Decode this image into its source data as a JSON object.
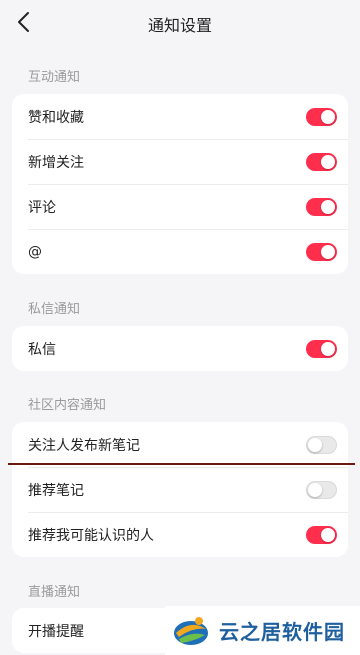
{
  "header": {
    "title": "通知设置",
    "back_icon": "chevron-left-icon"
  },
  "sections": [
    {
      "title": "互动通知",
      "items": [
        {
          "label": "赞和收藏",
          "enabled": true
        },
        {
          "label": "新增关注",
          "enabled": true
        },
        {
          "label": "评论",
          "enabled": true
        },
        {
          "label": "@",
          "enabled": true
        }
      ]
    },
    {
      "title": "私信通知",
      "items": [
        {
          "label": "私信",
          "enabled": true
        }
      ]
    },
    {
      "title": "社区内容通知",
      "items": [
        {
          "label": "关注人发布新笔记",
          "enabled": false
        },
        {
          "label": "推荐笔记",
          "enabled": false
        },
        {
          "label": "推荐我可能认识的人",
          "enabled": true
        }
      ]
    },
    {
      "title": "直播通知",
      "items": [
        {
          "label": "开播提醒",
          "enabled": true
        }
      ]
    }
  ],
  "watermark": {
    "text": "云之居软件园"
  },
  "colors": {
    "toggle_on": "#ff2e4d",
    "toggle_off": "#e9e9ea",
    "annotation_line": "#6b1a12"
  }
}
